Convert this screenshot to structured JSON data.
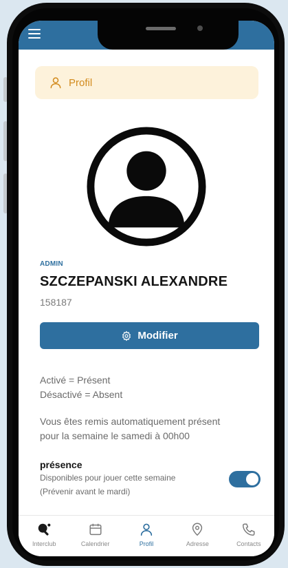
{
  "colors": {
    "primary": "#2e6f9f",
    "banner_bg": "#fdf2db",
    "banner_text": "#d28a1c",
    "frame": "#0c0c0c",
    "background": "#dbe7f0"
  },
  "topbar": {
    "menu_icon": "hamburger-menu-icon"
  },
  "banner": {
    "label": "Profil",
    "icon": "person-icon"
  },
  "profile": {
    "avatar_icon": "user-avatar-icon",
    "role": "ADMIN",
    "name": "SZCZEPANSKI ALEXANDRE",
    "id": "158187",
    "edit_button_label": "Modifier",
    "edit_button_icon": "gear-icon"
  },
  "legend": {
    "active": "Activé = Présent",
    "inactive": "Désactivé = Absent"
  },
  "auto_notice": {
    "line1": "Vous êtes remis automatiquement présent",
    "line2": "pour la semaine le samedi à 00h00"
  },
  "presence": {
    "title": "présence",
    "subtitle_line1": "Disponibles pour jouer cette semaine",
    "subtitle_line2": "(Prévenir avant le mardi)",
    "enabled": true
  },
  "tabs": [
    {
      "label": "Interclub",
      "icon": "ping-pong-icon",
      "active": false
    },
    {
      "label": "Calendrier",
      "icon": "calendar-icon",
      "active": false
    },
    {
      "label": "Profil",
      "icon": "person-icon",
      "active": true
    },
    {
      "label": "Adresse",
      "icon": "location-pin-icon",
      "active": false
    },
    {
      "label": "Contacts",
      "icon": "phone-icon",
      "active": false
    }
  ]
}
